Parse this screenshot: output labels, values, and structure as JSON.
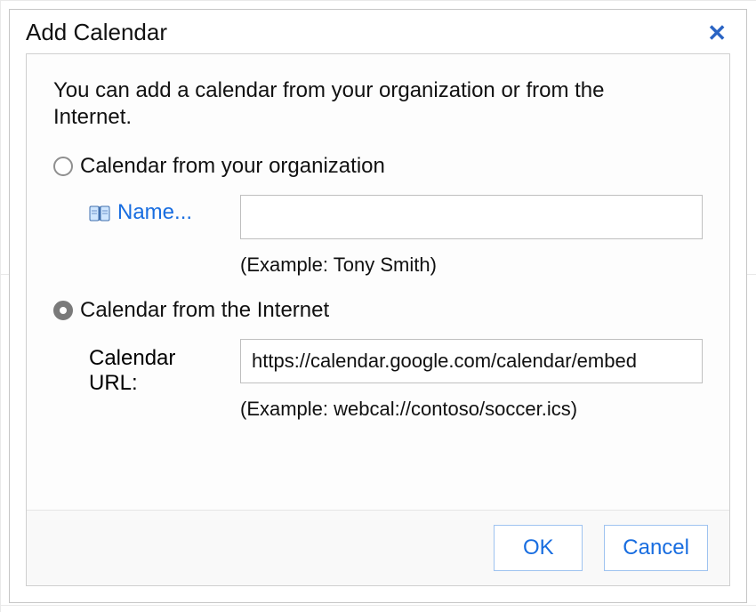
{
  "dialog": {
    "title": "Add Calendar",
    "close_label": "✕",
    "intro": "You can add a calendar from your organization or from the Internet.",
    "option_org": {
      "label": "Calendar from your organization",
      "selected": false,
      "name_link": "Name...",
      "name_value": "",
      "name_example": "(Example: Tony Smith)"
    },
    "option_internet": {
      "label": "Calendar from the Internet",
      "selected": true,
      "url_label": "Calendar URL:",
      "url_value": "https://calendar.google.com/calendar/embed",
      "url_example": "(Example: webcal://contoso/soccer.ics)"
    },
    "buttons": {
      "ok": "OK",
      "cancel": "Cancel"
    }
  }
}
